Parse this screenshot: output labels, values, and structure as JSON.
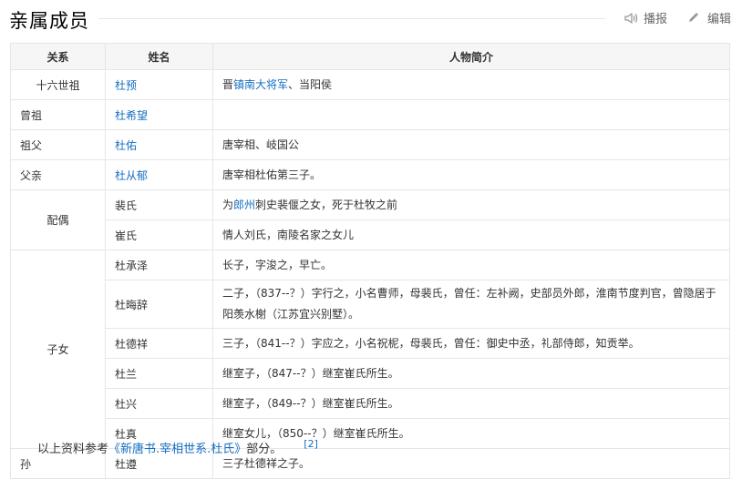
{
  "section": {
    "title": "亲属成员"
  },
  "actions": {
    "play_label": "播报",
    "edit_label": "编辑"
  },
  "table": {
    "headers": [
      "关系",
      "姓名",
      "人物简介"
    ],
    "rows": {
      "r1": {
        "rel": "十六世祖",
        "name": "杜预",
        "bio_pre": "晋",
        "bio_link": "镇南大将军",
        "bio_post": "、当阳侯"
      },
      "r2": {
        "rel": "曾祖",
        "name": "杜希望",
        "bio": ""
      },
      "r3": {
        "rel": "祖父",
        "name": "杜佑",
        "bio": "唐宰相、岐国公"
      },
      "r4": {
        "rel": "父亲",
        "name": "杜从郁",
        "bio": "唐宰相杜佑第三子。"
      },
      "r5": {
        "rel": "配偶",
        "name": "裴氏",
        "bio_pre": "为",
        "bio_link": "郎州",
        "bio_post": "刺史裴偃之女，死于杜牧之前"
      },
      "r6": {
        "name": "崔氏",
        "bio": "情人刘氏，南陵名家之女儿"
      },
      "r7": {
        "rel": "子女",
        "name": "杜承泽",
        "bio": "长子，字浚之，早亡。"
      },
      "r8": {
        "name": "杜晦辞",
        "bio": "二子，（837--？）字行之，小名曹师，母裴氏，曾任：左补阙，史部员外郎，淮南节度判官，曾隐居于阳羡水榭（江苏宜兴别墅）。"
      },
      "r9": {
        "name": "杜德祥",
        "bio": "三子，（841--？）字应之，小名祝柅，母裴氏，曾任：御史中丞，礼部侍郎，知贡举。"
      },
      "r10": {
        "name": "杜兰",
        "bio": "继室子，（847--？）继室崔氏所生。"
      },
      "r11": {
        "name": "杜兴",
        "bio": "继室子，（849--？）继室崔氏所生。"
      },
      "r12": {
        "name": "杜真",
        "bio": "继室女儿，（850--？）继室崔氏所生。"
      },
      "r13": {
        "rel": "孙",
        "name": "杜遵",
        "bio": "三子杜德祥之子。"
      }
    }
  },
  "footer": {
    "pre": "以上资料参考",
    "link": "《新唐书.宰相世系.杜氏》",
    "post": "部分。",
    "ref": "[2]"
  }
}
